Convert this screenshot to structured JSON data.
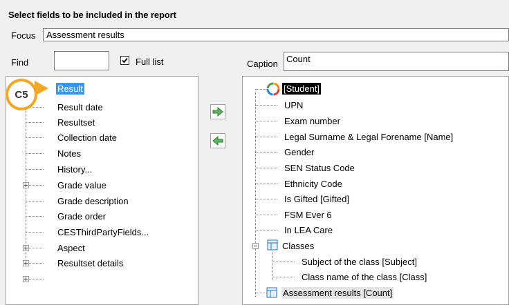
{
  "header": {
    "title": "Select fields to be included in the report"
  },
  "focus": {
    "label": "Focus",
    "value": "Assessment results"
  },
  "find": {
    "label": "Find",
    "value": ""
  },
  "full_list": {
    "label": "Full list",
    "checked": true
  },
  "caption": {
    "label": "Caption",
    "value": "Count"
  },
  "badge": {
    "text": "C5"
  },
  "left_tree": {
    "items": [
      {
        "label": "Result"
      },
      {
        "label": "Result date"
      },
      {
        "label": "Resultset"
      },
      {
        "label": "Collection date"
      },
      {
        "label": "Notes"
      },
      {
        "label": "History..."
      },
      {
        "label": "Grade value"
      },
      {
        "label": "Grade description"
      },
      {
        "label": "Grade order"
      },
      {
        "label": "CESThirdPartyFields..."
      },
      {
        "label": "Aspect"
      },
      {
        "label": "Resultset details"
      }
    ]
  },
  "right_tree": {
    "items": [
      {
        "label": "[Student]"
      },
      {
        "label": "UPN"
      },
      {
        "label": "Exam number"
      },
      {
        "label": "Legal Surname & Legal Forename [Name]"
      },
      {
        "label": "Gender"
      },
      {
        "label": "SEN Status Code"
      },
      {
        "label": "Ethnicity Code"
      },
      {
        "label": "Is Gifted [Gifted]"
      },
      {
        "label": "FSM Ever 6"
      },
      {
        "label": "In LEA Care"
      },
      {
        "label": "Classes"
      },
      {
        "label": "Subject of the class [Subject]"
      },
      {
        "label": "Class name of the class [Class]"
      },
      {
        "label": "Assessment results [Count]"
      }
    ]
  },
  "colors": {
    "badge": "#f5a623",
    "selection": "#3399ff",
    "arrow": "#4caf50"
  }
}
